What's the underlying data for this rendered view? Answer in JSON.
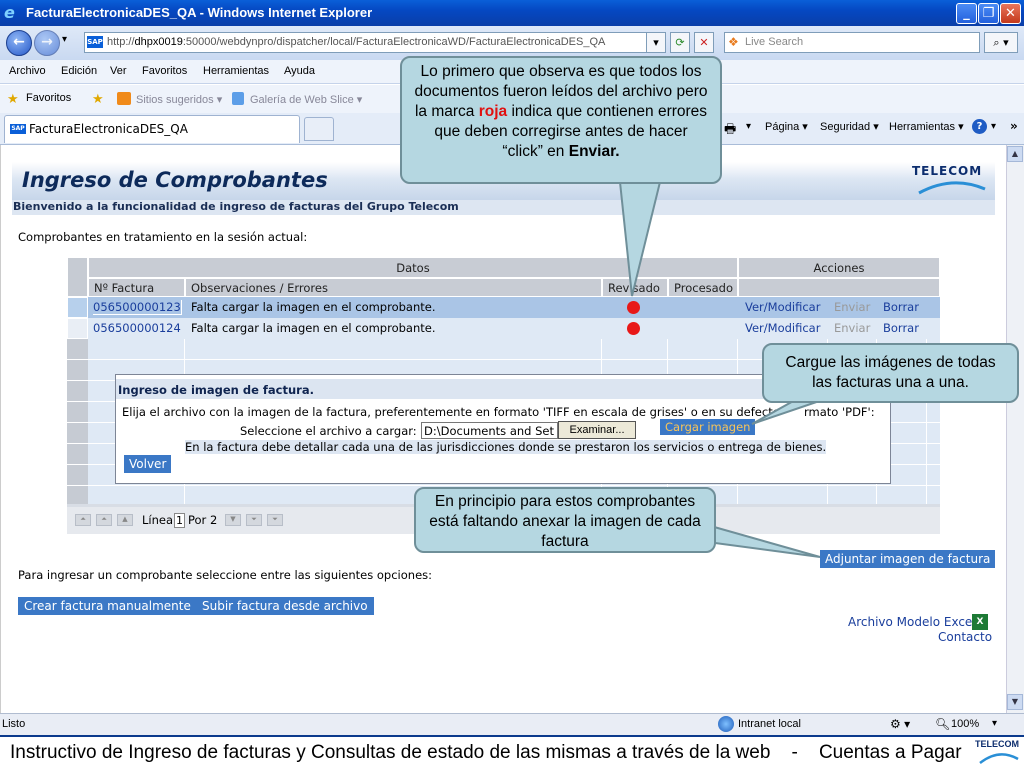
{
  "window": {
    "title": "FacturaElectronicaDES_QA - Windows Internet Explorer"
  },
  "address": {
    "prefix": "http://",
    "host": "dhpx0019",
    "rest": ":50000/webdynpro/dispatcher/local/FacturaElectronicaWD/FacturaElectronicaDES_QA"
  },
  "search": {
    "placeholder": "Live Search"
  },
  "menu": [
    "Archivo",
    "Edición",
    "Ver",
    "Favoritos",
    "Herramientas",
    "Ayuda"
  ],
  "favbar": {
    "favorites": "Favoritos",
    "suggested": "Sitios sugeridos ▾",
    "webslice": "Galería de Web Slice ▾"
  },
  "tab": {
    "label": "FacturaElectronicaDES_QA"
  },
  "commandbar": {
    "page": "Página ▾",
    "security": "Seguridad ▾",
    "tools": "Herramientas ▾"
  },
  "page": {
    "title": "Ingreso de Comprobantes",
    "logo": "TELECOM",
    "welcome": "Bienvenido a la funcionalidad de ingreso de facturas del Grupo Telecom",
    "session_label": "Comprobantes en tratamiento en la sesión actual:",
    "options_label": "Para ingresar un comprobante seleccione entre las siguientes opciones:",
    "create_manual": "Crear factura manualmente",
    "upload_file": "Subir factura desde archivo",
    "attach_image": "Adjuntar imagen de factura",
    "excel_link": "Archivo Modelo Excel",
    "contact_link": "Contacto"
  },
  "table": {
    "group_data": "Datos",
    "group_actions": "Acciones",
    "columns": [
      "Nº Factura",
      "Observaciones / Errores",
      "Revisado",
      "Procesado"
    ],
    "rows": [
      {
        "invoice": "056500000123",
        "obs": "Falta cargar la imagen en el comprobante.",
        "reviewed": "error",
        "view": "Ver/Modificar",
        "send": "Enviar",
        "delete": "Borrar"
      },
      {
        "invoice": "056500000124",
        "obs": "Falta cargar la imagen en el comprobante.",
        "reviewed": "error",
        "view": "Ver/Modificar",
        "send": "Enviar",
        "delete": "Borrar"
      }
    ],
    "pager": {
      "line_label": "Línea",
      "line_value": "1",
      "of_label": "Por 2"
    }
  },
  "popup": {
    "title": "Ingreso de imagen de factura.",
    "instructions_a": "Elija el archivo con la imagen de la factura, preferentemente en formato 'TIFF en escala de grises' o en su defecto",
    "instructions_b": "rmato 'PDF':",
    "file_label": "Seleccione el archivo a cargar:",
    "file_value": "D:\\Documents and Set",
    "browse": "Examinar...",
    "load": "Cargar imagen",
    "note": "En la factura debe detallar cada una de las jurisdicciones donde se prestaron los servicios o entrega de bienes.",
    "back": "Volver"
  },
  "callouts": {
    "top_a": "Lo primero que observa  es que todos los documentos fueron leídos del archivo pero la marca ",
    "top_red": "roja",
    "top_b": " indica que contienen errores que deben corregirse antes de hacer “click” en ",
    "top_bold": "Enviar.",
    "right": "Cargue las imágenes de todas las facturas una a una.",
    "bottom": "En principio para estos comprobantes está faltando anexar la imagen de cada factura"
  },
  "status": {
    "text": "Listo",
    "zone": "Intranet local",
    "zoom": "100%"
  },
  "footer": {
    "text": "Instructivo de Ingreso de facturas y Consultas de estado de las mismas a través de la web    -    Cuentas a Pagar",
    "logo": "TELECOM"
  },
  "colors": {
    "accent": "#3b78c6",
    "error": "#e81818",
    "callout": "#b5d7e1",
    "titlebar": "#0548c2"
  }
}
